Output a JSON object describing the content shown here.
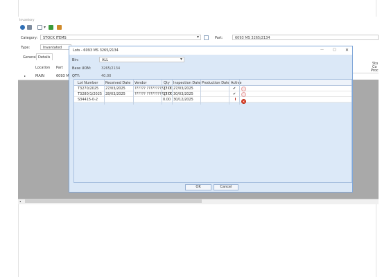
{
  "window": {
    "title": "Invantory"
  },
  "toolbar": {
    "icons": [
      "info-icon",
      "list-icon",
      "new-icon",
      "download-icon",
      "upload-icon"
    ]
  },
  "header": {
    "category_label": "Category:",
    "category_value": "STOCK ITEMS",
    "part_label": "Part:",
    "part_value": "6093 MS 3265/2134",
    "type_label": "Type:",
    "type_value": "Invantated"
  },
  "tabs": [
    {
      "label": "General"
    },
    {
      "label": "Details"
    }
  ],
  "grid": {
    "columns": [
      "Location",
      "Part"
    ],
    "row": {
      "location": "MAIN",
      "part": "6093 MS"
    },
    "right_header": [
      "Sto",
      "Co",
      "Proc"
    ]
  },
  "dialog": {
    "title": "Lots - 6093 MS 3265/2134",
    "bin_label": "Bin:",
    "bin_value": "ALL",
    "base_uom_label": "Base UOM:",
    "base_uom_value": "3265/2134",
    "qty_label": "QTY:",
    "qty_value": "40.00",
    "table": {
      "columns": [
        "Lot Number",
        "Received Date",
        "Vendor",
        "Qty",
        "Inspection Date",
        "Production Date",
        "Active"
      ],
      "rows": [
        {
          "lot": "T3270/2025",
          "received": "27/03/2025",
          "vendor": "?????? ????????? [???",
          "qty": "27.00",
          "inspection": "27/03/2025",
          "production": "",
          "active": true
        },
        {
          "lot": "T3280/1/2025",
          "received": "28/03/2025",
          "vendor": "?????? ????????? [???",
          "qty": "13.00",
          "inspection": "30/03/2025",
          "production": "",
          "active": true
        },
        {
          "lot": "S34415-0-2",
          "received": "",
          "vendor": "",
          "qty": "0.00",
          "inspection": "30/12/2025",
          "production": "",
          "active": false
        }
      ]
    },
    "ok_label": "OK",
    "cancel_label": "Cancel"
  }
}
